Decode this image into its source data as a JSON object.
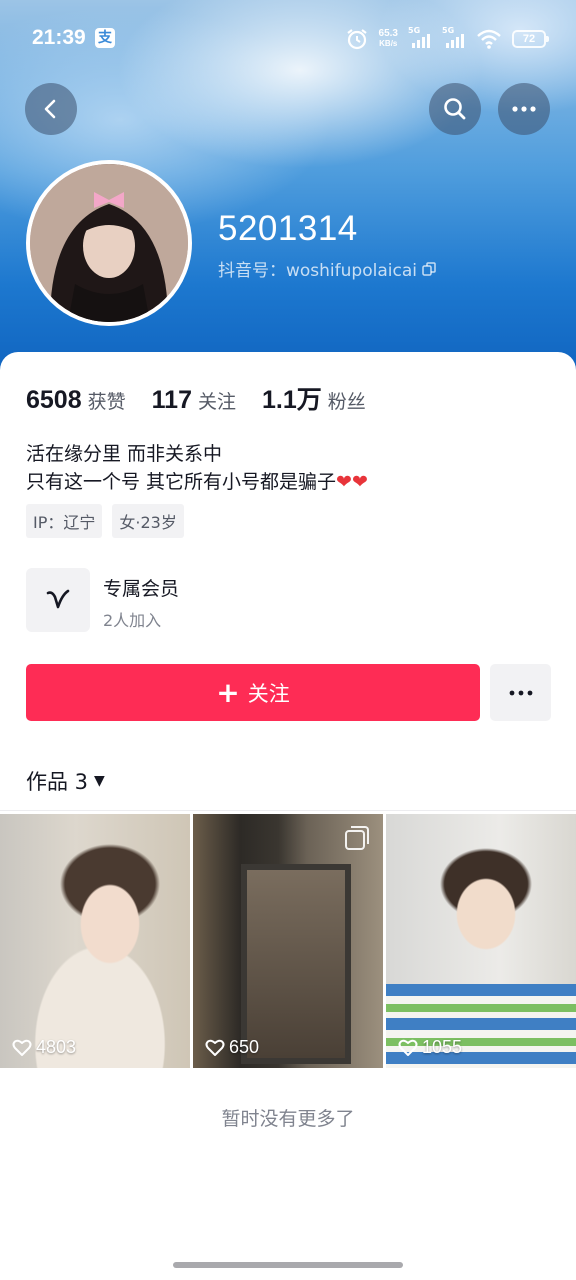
{
  "status_bar": {
    "time": "21:39",
    "app_icon": "支",
    "net_speed_value": "65.3",
    "net_speed_unit": "KB/s",
    "signal1_label": "5G",
    "signal2_label": "5G",
    "battery": "72"
  },
  "profile": {
    "name": "5201314",
    "douyin_id": "抖音号：woshifupolaicai"
  },
  "stats": [
    {
      "value": "6508",
      "label": "获赞"
    },
    {
      "value": "117",
      "label": "关注"
    },
    {
      "value": "1.1万",
      "label": "粉丝"
    }
  ],
  "bio": {
    "line1": "活在缘分里 而非关系中",
    "line2": "只有这一个号 其它所有小号都是骗子"
  },
  "tags": [
    "IP：辽宁",
    "女·23岁"
  ],
  "member": {
    "title": "专属会员",
    "subtitle": "2人加入"
  },
  "actions": {
    "follow_label": "关注"
  },
  "works": {
    "title": "作品 3",
    "videos": [
      {
        "likes": "4803"
      },
      {
        "likes": "650"
      },
      {
        "likes": "1055"
      }
    ]
  },
  "footer": {
    "no_more_text": "暂时没有更多了"
  },
  "colors": {
    "follow_button": "#fe2c55",
    "heart": "#e8343a"
  }
}
